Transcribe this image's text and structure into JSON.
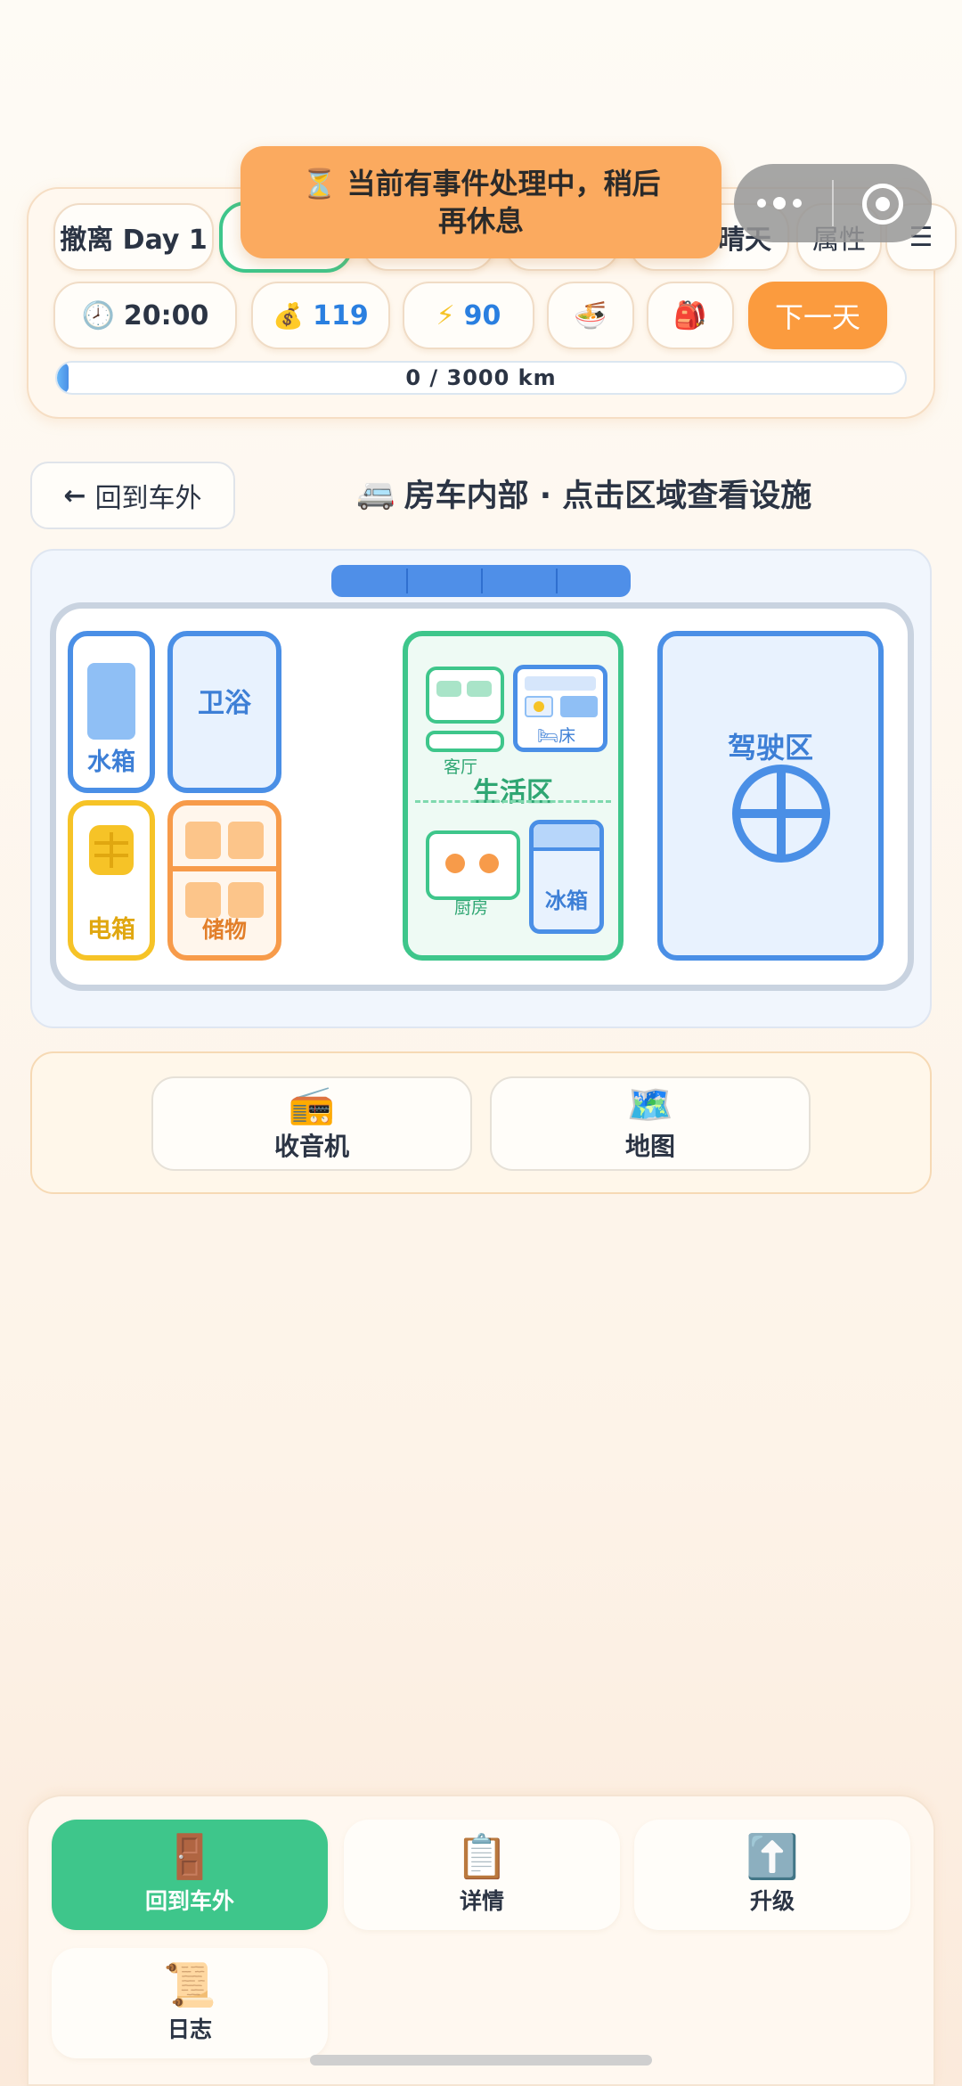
{
  "toast": {
    "icon": "⏳",
    "line1": "当前有事件处理中，稍后",
    "line2": "再休息"
  },
  "status_bar": {
    "day_label": "撤离 Day 1",
    "weather_fragment": "晴天",
    "attributes_label": "属性",
    "menu_icon": "☰",
    "time": "20:00",
    "time_icon": "🕗",
    "money": "119",
    "money_icon": "💰",
    "energy": "90",
    "energy_icon": "⚡",
    "food_icon": "🍜",
    "bag_icon": "🎒",
    "next_day_label": "下一天",
    "progress_text": "0 / 3000 km",
    "progress_fraction": 0.0
  },
  "header": {
    "back_label": "回到车外",
    "back_icon": "←",
    "title_icon": "🚐",
    "title": "房车内部 · 点击区域查看设施"
  },
  "van": {
    "water_tank": "水箱",
    "bathroom": "卫浴",
    "power_box": "电箱",
    "storage": "储物",
    "living_room": "客厅",
    "bed": "床",
    "bed_icon": "🛏",
    "living_area": "生活区",
    "kitchen": "厨房",
    "fridge": "冰箱",
    "driving_area": "驾驶区"
  },
  "tools": [
    {
      "icon": "📻",
      "label": "收音机"
    },
    {
      "icon": "🗺️",
      "label": "地图"
    }
  ],
  "bottom_nav": [
    {
      "icon": "🚪",
      "label": "回到车外"
    },
    {
      "icon": "📋",
      "label": "详情"
    },
    {
      "icon": "⬆️",
      "label": "升级"
    },
    {
      "icon": "📜",
      "label": "日志"
    }
  ],
  "colors": {
    "accent_green": "#3ec68b",
    "accent_orange": "#fb9b3e",
    "blue": "#4a8fe6",
    "yellow": "#f6c327"
  }
}
